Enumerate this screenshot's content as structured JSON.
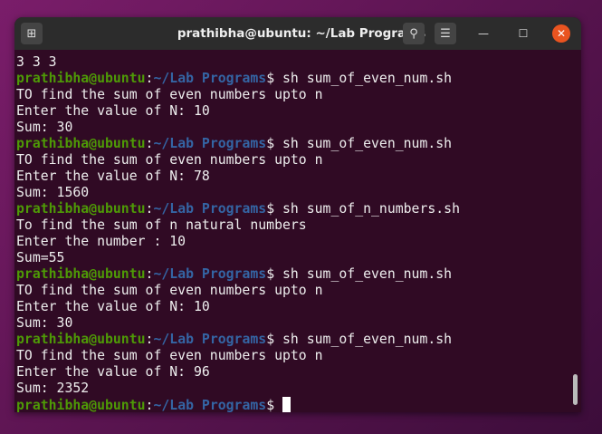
{
  "window": {
    "title": "prathibha@ubuntu: ~/Lab Programs"
  },
  "icons": {
    "new_tab": "new-tab-icon",
    "search": "search-icon",
    "menu": "hamburger-menu-icon",
    "minimize": "minimize-icon",
    "maximize": "maximize-icon",
    "close": "close-icon"
  },
  "colors": {
    "user": "#4e9a06",
    "path": "#3465a4",
    "background": "#300a24",
    "close": "#e95420"
  },
  "prompt": {
    "user": "prathibha@ubuntu",
    "sep": ":",
    "path": "~/Lab Programs",
    "dollar": "$ "
  },
  "lines": [
    {
      "text": "3 3 3"
    },
    {
      "cmd": "sh sum_of_even_num.sh"
    },
    {
      "text": "TO find the sum of even numbers upto n"
    },
    {
      "text": "Enter the value of N: 10"
    },
    {
      "text": "Sum: 30"
    },
    {
      "cmd": "sh sum_of_even_num.sh"
    },
    {
      "text": "TO find the sum of even numbers upto n"
    },
    {
      "text": "Enter the value of N: 78"
    },
    {
      "text": "Sum: 1560"
    },
    {
      "cmd": "sh sum_of_n_numbers.sh"
    },
    {
      "text": "To find the sum of n natural numbers"
    },
    {
      "text": "Enter the number : 10"
    },
    {
      "text": "Sum=55"
    },
    {
      "cmd": "sh sum_of_even_num.sh"
    },
    {
      "text": "TO find the sum of even numbers upto n"
    },
    {
      "text": "Enter the value of N: 10"
    },
    {
      "text": "Sum: 30"
    },
    {
      "cmd": "sh sum_of_even_num.sh"
    },
    {
      "text": "TO find the sum of even numbers upto n"
    },
    {
      "text": "Enter the value of N: 96"
    },
    {
      "text": "Sum: 2352"
    },
    {
      "cmd": ""
    }
  ]
}
